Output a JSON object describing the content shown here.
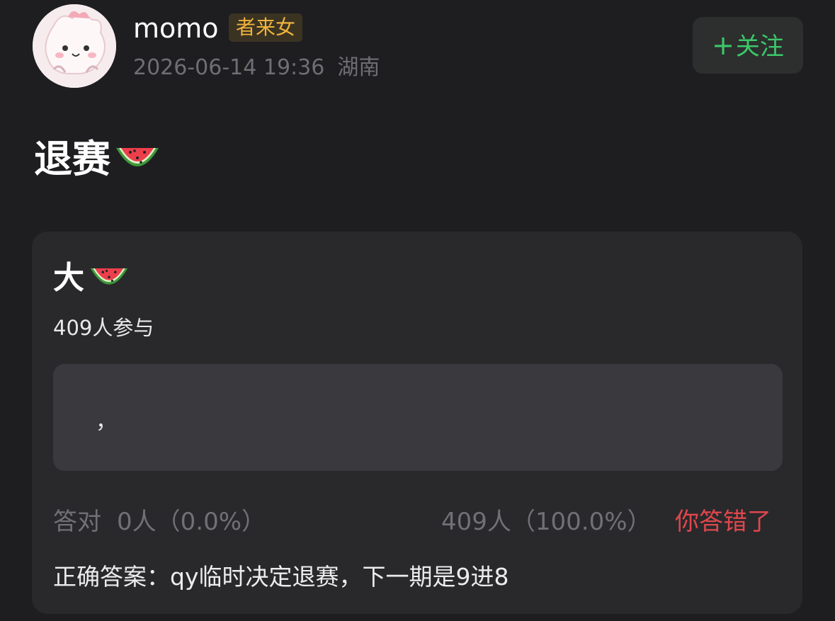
{
  "header": {
    "username": "momo",
    "badge": "者来女",
    "date": "2026-06-14 19:36",
    "location": "湖南",
    "follow_plus": "+",
    "follow_label": "关注"
  },
  "post": {
    "title": "退赛",
    "title_emoji": "watermelon-icon"
  },
  "quiz": {
    "title": "大",
    "title_emoji": "watermelon-icon",
    "participants": "409人参与",
    "option_text": "，",
    "correct_label": "答对",
    "correct_value": "0人（0.0%）",
    "wrong_value": "409人（100.0%）",
    "result": "你答错了",
    "answer": "正确答案：qy临时决定退赛，下一期是9进8"
  },
  "colors": {
    "background": "#1e1e21",
    "card": "#29292c",
    "option": "#3a3a3e",
    "follow_green": "#3cc86a",
    "badge_gold": "#f0b33c",
    "wrong_red": "#e0474c"
  }
}
